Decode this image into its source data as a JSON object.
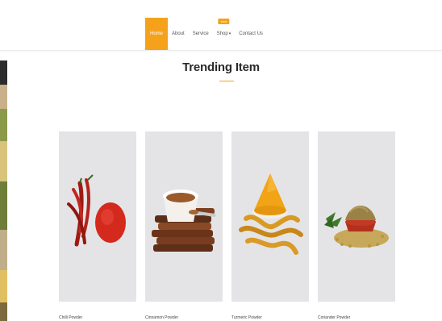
{
  "nav": {
    "items": [
      {
        "label": "Home",
        "active": true
      },
      {
        "label": "About"
      },
      {
        "label": "Service"
      },
      {
        "label": "Shop",
        "badge": "new",
        "has_dropdown": true
      },
      {
        "label": "Contact Us"
      }
    ],
    "accent": "#f5a21a"
  },
  "section": {
    "title": "Trending Item"
  },
  "products": [
    {
      "name": "Chilli Powder",
      "icon": "chilli-powder-image"
    },
    {
      "name": "Cinnamon Powder",
      "icon": "cinnamon-powder-image"
    },
    {
      "name": "Turmeric Powder",
      "icon": "turmeric-powder-image"
    },
    {
      "name": "Coriander Powder",
      "icon": "coriander-powder-image"
    }
  ],
  "colors": {
    "card_bg": "#e4e4e6",
    "accent": "#f5a21a"
  }
}
